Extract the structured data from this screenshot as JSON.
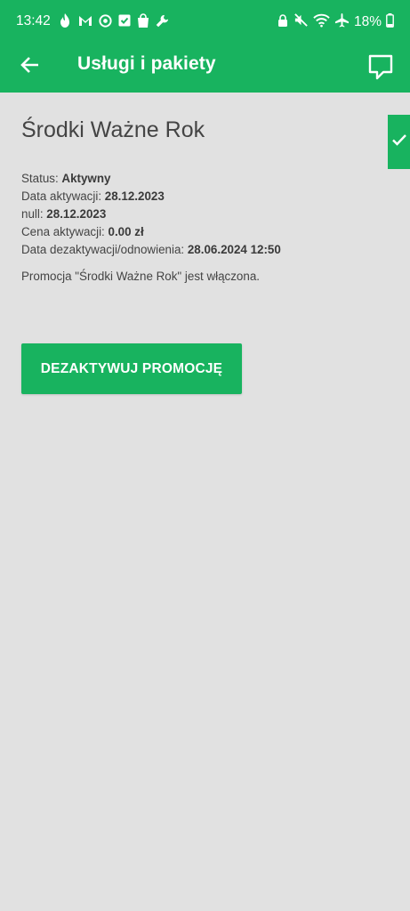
{
  "status_bar": {
    "time": "13:42",
    "battery": "18%",
    "left_icons": [
      "fire-icon",
      "gmail-icon",
      "sync-icon",
      "checkbox-icon",
      "shopping-bag-icon",
      "wrench-icon"
    ],
    "right_icons": [
      "lock-icon",
      "mute-icon",
      "wifi-icon",
      "airplane-icon",
      "battery-icon"
    ]
  },
  "toolbar": {
    "title": "Usługi i pakiety",
    "back_icon": "arrow-left-icon",
    "chat_icon": "chat-bubble-icon"
  },
  "promo": {
    "title": "Środki Ważne Rok",
    "status_label": "Status: ",
    "status_value": "Aktywny",
    "activation_date_label": "Data aktywacji: ",
    "activation_date_value": "28.12.2023",
    "null_label": "null: ",
    "null_value": "28.12.2023",
    "price_label": "Cena aktywacji: ",
    "price_value": "0.00 zł",
    "deactivation_label": "Data dezaktywacji/odnowienia: ",
    "deactivation_value": "28.06.2024 12:50",
    "note": "Promocja \"Środki Ważne Rok\" jest włączona.",
    "deactivate_button": "DEZAKTYWUJ PROMOCJĘ"
  },
  "side_tab": {
    "icon": "check-icon"
  },
  "colors": {
    "brand_green": "#18b35f",
    "background": "#e1e1e1",
    "text": "#444444"
  }
}
